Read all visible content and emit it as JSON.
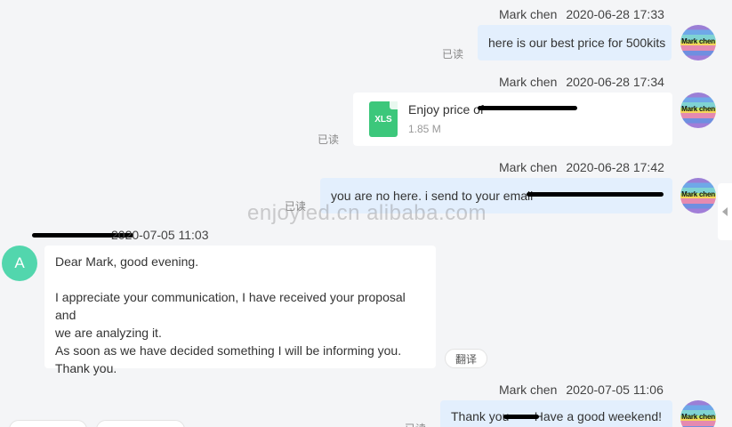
{
  "watermark": "enjoyled.cn alibaba.com",
  "read_label": "已读",
  "translate_label": "翻译",
  "messages": [
    {
      "sender": "Mark chen",
      "time": "2020-06-28 17:33",
      "text": "here is our best price for 500kits"
    },
    {
      "sender": "Mark chen",
      "time": "2020-06-28 17:34",
      "file_name": "Enjoy price of",
      "file_type": "XLS",
      "file_size": "1.85 M"
    },
    {
      "sender": "Mark chen",
      "time": "2020-06-28 17:42",
      "text": "you are no here. i send to your email"
    },
    {
      "sender_partial": "A",
      "time": "2020-07-05 11:03",
      "avatar_letter": "A",
      "lines": [
        "Dear Mark, good evening.",
        "",
        "I appreciate your communication, I have received your proposal and",
        "we are analyzing it.",
        "As soon as we have decided something I will be informing you.",
        "Thank you."
      ]
    },
    {
      "sender": "Mark chen",
      "time": "2020-07-05 11:06",
      "text_before": "Thank you",
      "text_after": "Have a good weekend!"
    }
  ],
  "avatar_text": "Mark chen",
  "colors": {
    "outgoing_bubble": "#e3effd",
    "incoming_bubble": "#ffffff",
    "background": "#f4f5f7",
    "avatar_incoming": "#52d6ad",
    "xls_icon": "#3cc77b"
  }
}
